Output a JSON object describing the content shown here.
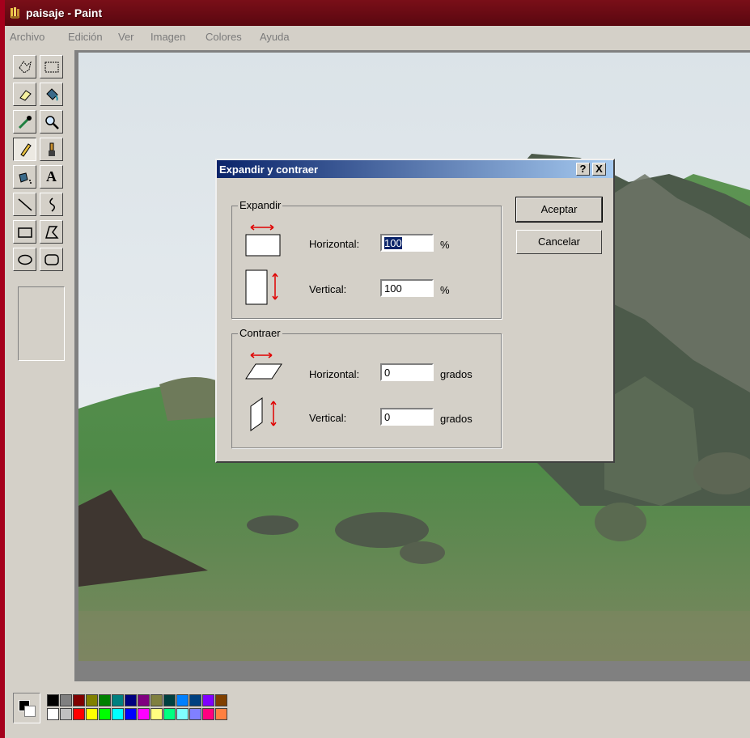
{
  "window": {
    "title": "paisaje - Paint"
  },
  "menu": [
    "Archivo",
    "Edición",
    "Ver",
    "Imagen",
    "Colores",
    "Ayuda"
  ],
  "tools": [
    "free-select",
    "rect-select",
    "eraser",
    "fill",
    "color-picker",
    "magnifier",
    "pencil",
    "brush",
    "airbrush",
    "text",
    "line",
    "curve",
    "rectangle",
    "polygon",
    "ellipse",
    "rounded-rectangle"
  ],
  "text_tool_glyph": "A",
  "palette": {
    "top": [
      "#000000",
      "#808080",
      "#800000",
      "#808000",
      "#008000",
      "#008080",
      "#000080",
      "#800080",
      "#808040",
      "#004040",
      "#0080ff",
      "#004080",
      "#8000ff",
      "#804000"
    ],
    "bottom": [
      "#ffffff",
      "#c0c0c0",
      "#ff0000",
      "#ffff00",
      "#00ff00",
      "#00ffff",
      "#0000ff",
      "#ff00ff",
      "#ffff80",
      "#00ff80",
      "#80ffff",
      "#8080ff",
      "#ff0080",
      "#ff8040"
    ]
  },
  "dialog": {
    "title": "Expandir y contraer",
    "help_label": "?",
    "close_label": "X",
    "accept_label": "Aceptar",
    "cancel_label": "Cancelar",
    "stretch": {
      "group_label": "Expandir",
      "horizontal_label": "Horizontal:",
      "horizontal_value": "100",
      "horizontal_unit": "%",
      "vertical_label": "Vertical:",
      "vertical_value": "100",
      "vertical_unit": "%"
    },
    "skew": {
      "group_label": "Contraer",
      "horizontal_label": "Horizontal:",
      "horizontal_value": "0",
      "horizontal_unit": "grados",
      "vertical_label": "Vertical:",
      "vertical_value": "0",
      "vertical_unit": "grados"
    }
  }
}
